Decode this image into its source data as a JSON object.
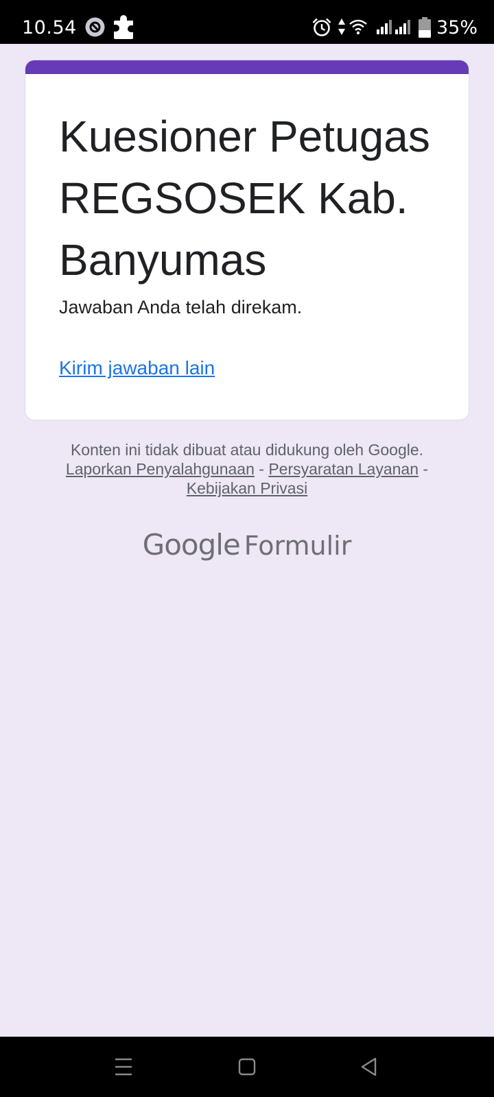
{
  "status_bar": {
    "time": "10.54",
    "battery": "35%",
    "icons": [
      "data-saver-icon",
      "puzzle-icon",
      "alarm-icon",
      "data-arrows-icon",
      "wifi-icon",
      "signal-sim1-icon",
      "signal-sim2-icon",
      "battery-icon"
    ]
  },
  "form": {
    "accent_color": "#673ab7",
    "title": "Kuesioner Petugas REGSOSEK Kab. Banyumas",
    "confirmation": "Jawaban Anda telah direkam.",
    "resubmit_link": "Kirim jawaban lain",
    "link_color": "#1a73e8"
  },
  "footer": {
    "disclaimer": "Konten ini tidak dibuat atau didukung oleh Google.",
    "links": [
      "Laporkan Penyalahgunaan",
      "Persyaratan Layanan",
      "Kebijakan Privasi"
    ],
    "separator": "-"
  },
  "branding": {
    "logo_google": "Google",
    "logo_product": "Formulir"
  },
  "nav_bar": {
    "icons": [
      "menu-icon",
      "home-square-icon",
      "back-triangle-icon"
    ]
  },
  "colors": {
    "page_background": "#ede7f6",
    "bars": "#000000"
  }
}
